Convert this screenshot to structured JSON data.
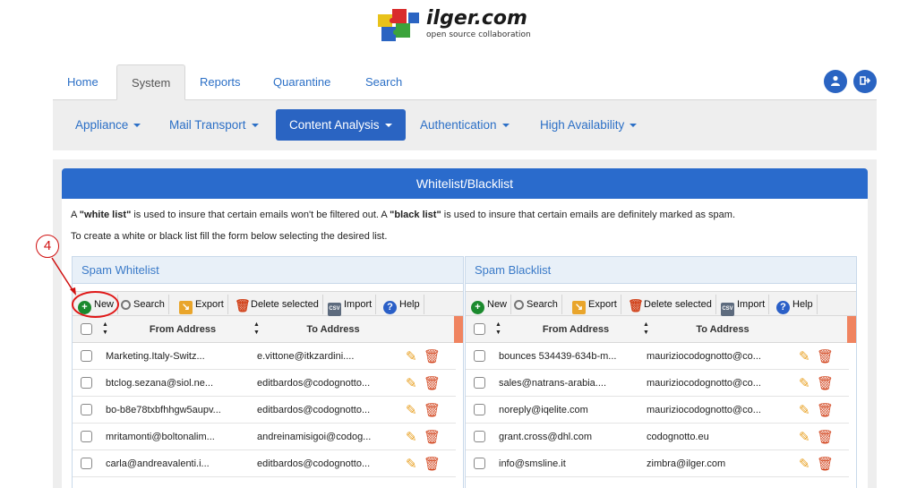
{
  "logo": {
    "text": "ilger.com",
    "subtitle": "open source collaboration"
  },
  "top_nav": {
    "tabs": [
      "Home",
      "System",
      "Reports",
      "Quarantine",
      "Search"
    ],
    "active": "System"
  },
  "sub_nav": {
    "items": [
      "Appliance",
      "Mail Transport",
      "Content Analysis",
      "Authentication",
      "High Availability"
    ],
    "active": "Content Analysis"
  },
  "panel": {
    "title": "Whitelist/Blacklist",
    "desc1_pre": "A ",
    "desc1_white": "\"white list\"",
    "desc1_mid": " is used to insure that certain emails won't be filtered out. A ",
    "desc1_black": "\"black list\"",
    "desc1_post": " is used to insure that certain emails are definitely marked as spam.",
    "desc2": "To create a white or black list fill the form below selecting the desired list."
  },
  "toolbar": {
    "new": "New",
    "search": "Search",
    "export": "Export",
    "delete": "Delete selected",
    "import": "Import",
    "help": "Help"
  },
  "columns": {
    "from": "From Address",
    "to": "To Address"
  },
  "whitelist": {
    "title": "Spam Whitelist",
    "rows": [
      {
        "from": "Marketing.Italy-Switz...",
        "to": "e.vittone@itkzardini...."
      },
      {
        "from": "btclog.sezana@siol.ne...",
        "to": "editbardos@codognotto..."
      },
      {
        "from": "bo-b8e78txbfhhgw5aupv...",
        "to": "editbardos@codognotto..."
      },
      {
        "from": "mritamonti@boltonalim...",
        "to": "andreinamisigoi@codog..."
      },
      {
        "from": "carla@andreavalenti.i...",
        "to": "editbardos@codognotto..."
      }
    ]
  },
  "blacklist": {
    "title": "Spam Blacklist",
    "rows": [
      {
        "from": "bounces 534439-634b-m...",
        "to": "mauriziocodognotto@co..."
      },
      {
        "from": "sales@natrans-arabia....",
        "to": "mauriziocodognotto@co..."
      },
      {
        "from": "noreply@iqelite.com",
        "to": "mauriziocodognotto@co..."
      },
      {
        "from": "grant.cross@dhl.com",
        "to": "codognotto.eu"
      },
      {
        "from": "info@smsline.it",
        "to": "zimbra@ilger.com"
      }
    ]
  },
  "annotation": {
    "label": "4"
  },
  "icons": {
    "user": "user-icon",
    "logout": "logout-icon",
    "new": "plus-circle-icon",
    "search": "magnifier-icon",
    "export": "export-icon",
    "delete": "trash-icon",
    "import": "csv-icon",
    "help": "question-icon",
    "edit": "pencil-icon"
  },
  "colors": {
    "accent": "#2a64c2",
    "header": "#2a6bcc",
    "link": "#2b6fc6",
    "delete": "#d2451e",
    "edit": "#e8a021",
    "annotation": "#d01010"
  }
}
